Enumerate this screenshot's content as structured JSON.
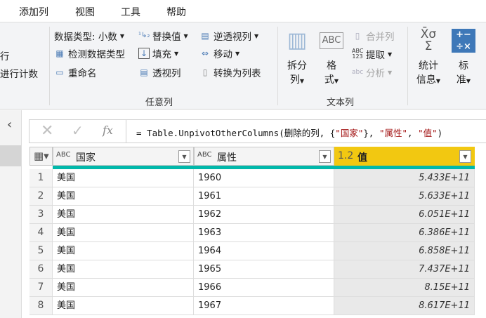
{
  "menu": {
    "tabs": [
      "添加列",
      "视图",
      "工具",
      "帮助"
    ]
  },
  "ribbon": {
    "left_partial": [
      "行",
      "进行计数"
    ],
    "any_column": {
      "label": "任意列",
      "data_type": "数据类型: 小数",
      "detect_type": "检测数据类型",
      "rename": "重命名",
      "replace_values": "替换值",
      "fill": "填充",
      "pivot": "透视列",
      "unpivot": "逆透视列",
      "move": "移动",
      "to_list": "转换为列表"
    },
    "text_column": {
      "label": "文本列",
      "split_1": "拆分",
      "split_2": "列",
      "format_1": "格",
      "format_2": "式",
      "merge": "合并列",
      "extract": "提取",
      "parse": "分析"
    },
    "number_column": {
      "stats_1": "统计",
      "stats_2": "信息",
      "standard_1": "标",
      "standard_2": "准"
    }
  },
  "formula": {
    "text": "= Table.UnpivotOtherColumns(删除的列, {\"国家\"}, \"属性\", \"值\")",
    "pre": "= Table.UnpivotOtherColumns(删除的列, {",
    "s1": "\"国家\"",
    "mid": "}, ",
    "s2": "\"属性\"",
    "comma": ", ",
    "s3": "\"值\"",
    "post": ")",
    "fx": "fx"
  },
  "table": {
    "columns": [
      {
        "name": "国家",
        "type": "ABC"
      },
      {
        "name": "属性",
        "type": "ABC"
      },
      {
        "name": "值",
        "type": "1.2"
      }
    ],
    "rows": [
      [
        "1",
        "美国",
        "1960",
        "5.433E+11"
      ],
      [
        "2",
        "美国",
        "1961",
        "5.633E+11"
      ],
      [
        "3",
        "美国",
        "1962",
        "6.051E+11"
      ],
      [
        "4",
        "美国",
        "1963",
        "6.386E+11"
      ],
      [
        "5",
        "美国",
        "1964",
        "6.858E+11"
      ],
      [
        "6",
        "美国",
        "1965",
        "7.437E+11"
      ],
      [
        "7",
        "美国",
        "1966",
        "8.15E+11"
      ],
      [
        "8",
        "美国",
        "1967",
        "8.617E+11"
      ]
    ]
  },
  "colors": {
    "teal": "#01b8aa",
    "selected_header": "#f2c811",
    "string": "#a31515"
  }
}
